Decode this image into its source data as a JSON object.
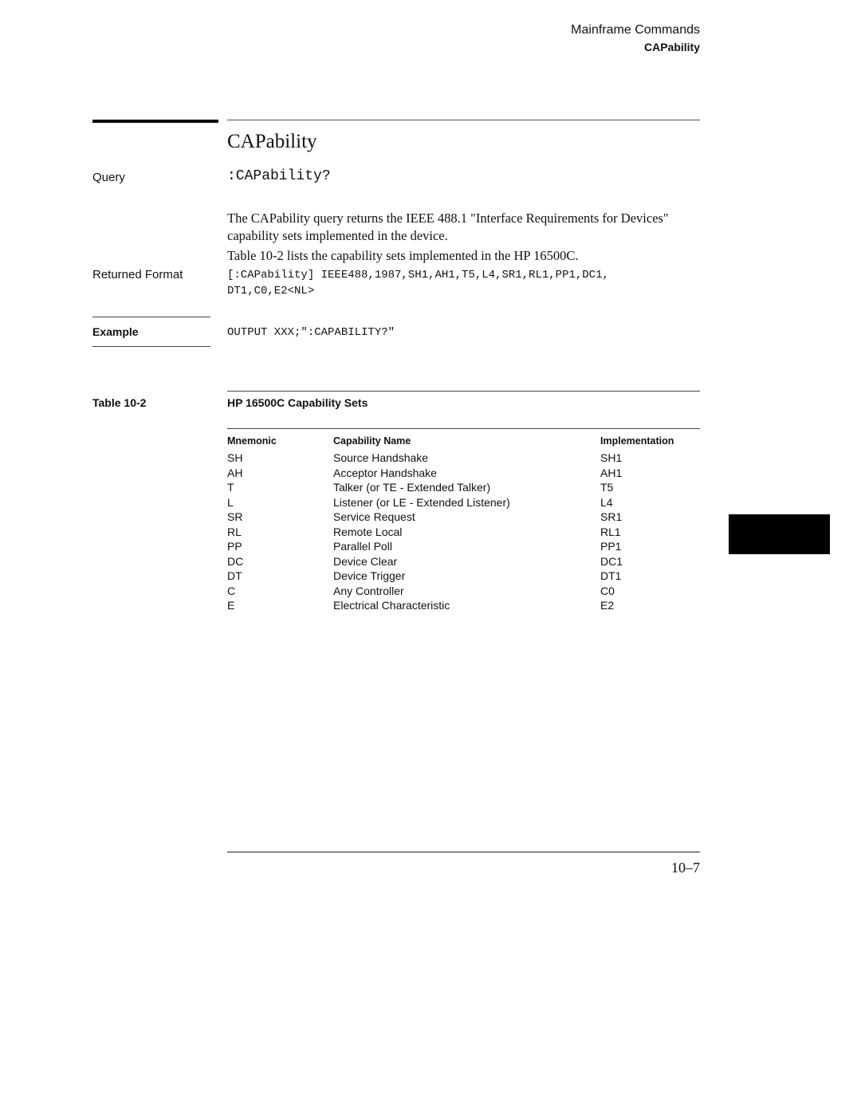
{
  "header": {
    "section": "Mainframe Commands",
    "command": "CAPability"
  },
  "title": "CAPability",
  "query": {
    "label": "Query",
    "syntax": ":CAPability?"
  },
  "description": [
    "The CAPability query returns the IEEE 488.1 \"Interface Requirements for Devices\" capability sets implemented in the device.",
    "Table 10-2 lists the capability sets implemented in the HP 16500C."
  ],
  "returned_format": {
    "label": "Returned Format",
    "line1": "[:CAPability] IEEE488,1987,SH1,AH1,T5,L4,SR1,RL1,PP1,DC1,",
    "line2": "DT1,C0,E2<NL>"
  },
  "example": {
    "label": "Example",
    "code": "OUTPUT XXX;\":CAPABILITY?\""
  },
  "table": {
    "number": "Table 10-2",
    "title": "HP 16500C Capability Sets",
    "columns": [
      "Mnemonic",
      "Capability Name",
      "Implementation"
    ],
    "rows": [
      [
        "SH",
        "Source Handshake",
        "SH1"
      ],
      [
        "AH",
        "Acceptor Handshake",
        "AH1"
      ],
      [
        "T",
        "Talker (or TE - Extended Talker)",
        "T5"
      ],
      [
        "L",
        "Listener (or LE - Extended Listener)",
        "L4"
      ],
      [
        "SR",
        "Service Request",
        "SR1"
      ],
      [
        "RL",
        "Remote Local",
        "RL1"
      ],
      [
        "PP",
        "Parallel Poll",
        "PP1"
      ],
      [
        "DC",
        "Device Clear",
        "DC1"
      ],
      [
        "DT",
        "Device Trigger",
        "DT1"
      ],
      [
        "C",
        "Any Controller",
        "C0"
      ],
      [
        "E",
        "Electrical Characteristic",
        "E2"
      ]
    ]
  },
  "footer": {
    "page_number": "10–7"
  }
}
